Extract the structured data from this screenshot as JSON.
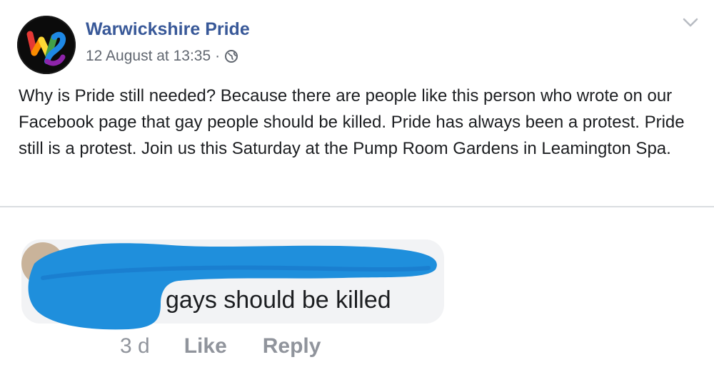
{
  "post": {
    "author": "Warwickshire Pride",
    "timestamp": "12 August at 13:35",
    "separator": "·",
    "audience_icon": "globe-icon",
    "menu_icon": "chevron-down-icon",
    "text": "Why is Pride still needed? Because there are people like this person who wrote on our Facebook page that gay people should be killed. Pride has always been a protest. Pride still is a protest. Join us this Saturday at the Pump Room Gardens in Leamington Spa."
  },
  "comment": {
    "text": "gays should be killed",
    "time": "3 d",
    "like_label": "Like",
    "reply_label": "Reply"
  },
  "colors": {
    "link": "#385898",
    "text": "#1c1e21",
    "meta": "#616770",
    "action": "#90949c",
    "bubble": "#f2f3f5",
    "redaction": "#1f8fdc"
  }
}
